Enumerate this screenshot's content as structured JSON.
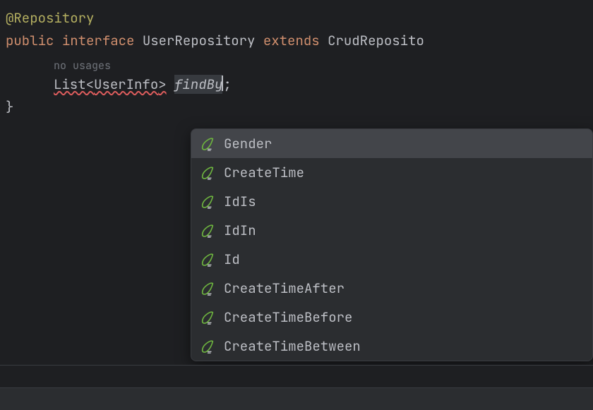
{
  "code": {
    "annotation": "@Repository",
    "declaration": {
      "kw_public": "public",
      "kw_interface": "interface",
      "name": "UserRepository",
      "kw_extends": "extends",
      "parent": "CrudReposito"
    },
    "usage_hint": "no usages",
    "method_line": {
      "return_type_open": "List<",
      "generic": "UserInfo",
      "return_type_close": ">",
      "method_prefix": "findBy",
      "suffix": ";"
    },
    "closing_brace": "}"
  },
  "completion": {
    "items": [
      {
        "label": "Gender",
        "selected": true
      },
      {
        "label": "CreateTime",
        "selected": false
      },
      {
        "label": "IdIs",
        "selected": false
      },
      {
        "label": "IdIn",
        "selected": false
      },
      {
        "label": "Id",
        "selected": false
      },
      {
        "label": "CreateTimeAfter",
        "selected": false
      },
      {
        "label": "CreateTimeBefore",
        "selected": false
      },
      {
        "label": "CreateTimeBetween",
        "selected": false
      }
    ]
  }
}
